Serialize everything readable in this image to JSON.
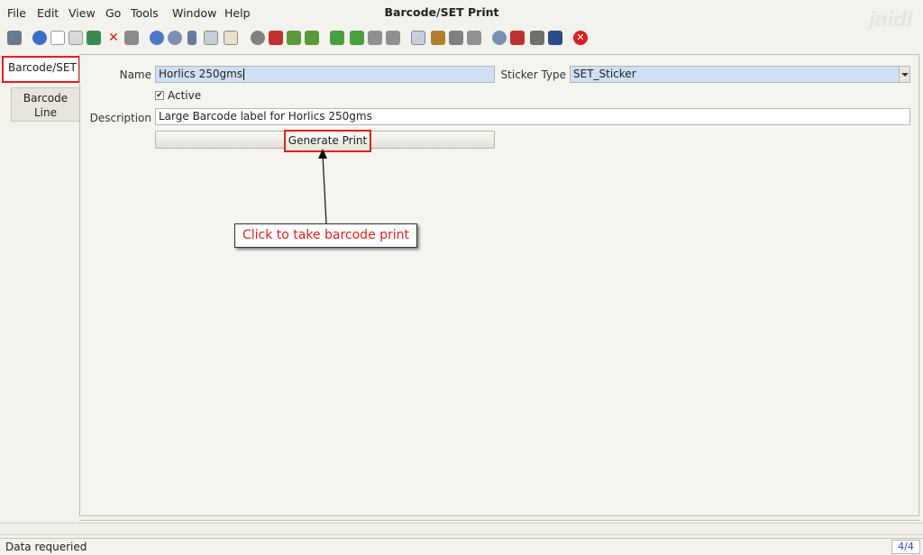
{
  "menu": {
    "items": [
      "File",
      "Edit",
      "View",
      "Go",
      "Tools",
      "Window",
      "Help"
    ]
  },
  "window_title": "Barcode/SET Print",
  "logo_text": "jaidi",
  "toolbar": {
    "icons": [
      "undo-icon",
      "help-icon",
      "new-icon",
      "copy-icon",
      "save-icon",
      "delete-icon",
      "print-preview-icon",
      "refresh-icon",
      "find-icon",
      "attachment-icon",
      "chat-icon",
      "grid-icon",
      "history-icon",
      "home-icon",
      "back-icon",
      "forward-icon",
      "first-icon",
      "previous-icon",
      "next-icon",
      "last-icon",
      "report-icon",
      "archive-icon",
      "print-icon",
      "print2-icon",
      "zoom-icon",
      "workflow-icon",
      "process-icon",
      "product-icon",
      "close-icon"
    ]
  },
  "left_tabs": {
    "selected": "Barcode/SET",
    "line_tab": "Barcode\nLine",
    "line_tab_l1": "Barcode",
    "line_tab_l2": "Line"
  },
  "form": {
    "name_label": "Name",
    "name_value": "Horlics 250gms",
    "sticker_type_label": "Sticker Type",
    "sticker_type_value": "SET_Sticker",
    "active_label": "Active",
    "active_checked": true,
    "description_label": "Description",
    "description_value": "Large Barcode label for Horlics 250gms",
    "generate_button": "Generate Print"
  },
  "annotation": {
    "callout_text": "Click to take barcode print"
  },
  "status": {
    "message": "Data requeried",
    "record_count": "4/4"
  },
  "colors": {
    "highlight_red": "#e02020",
    "field_blue": "#cfe0f5",
    "background": "#f4f2ec"
  }
}
